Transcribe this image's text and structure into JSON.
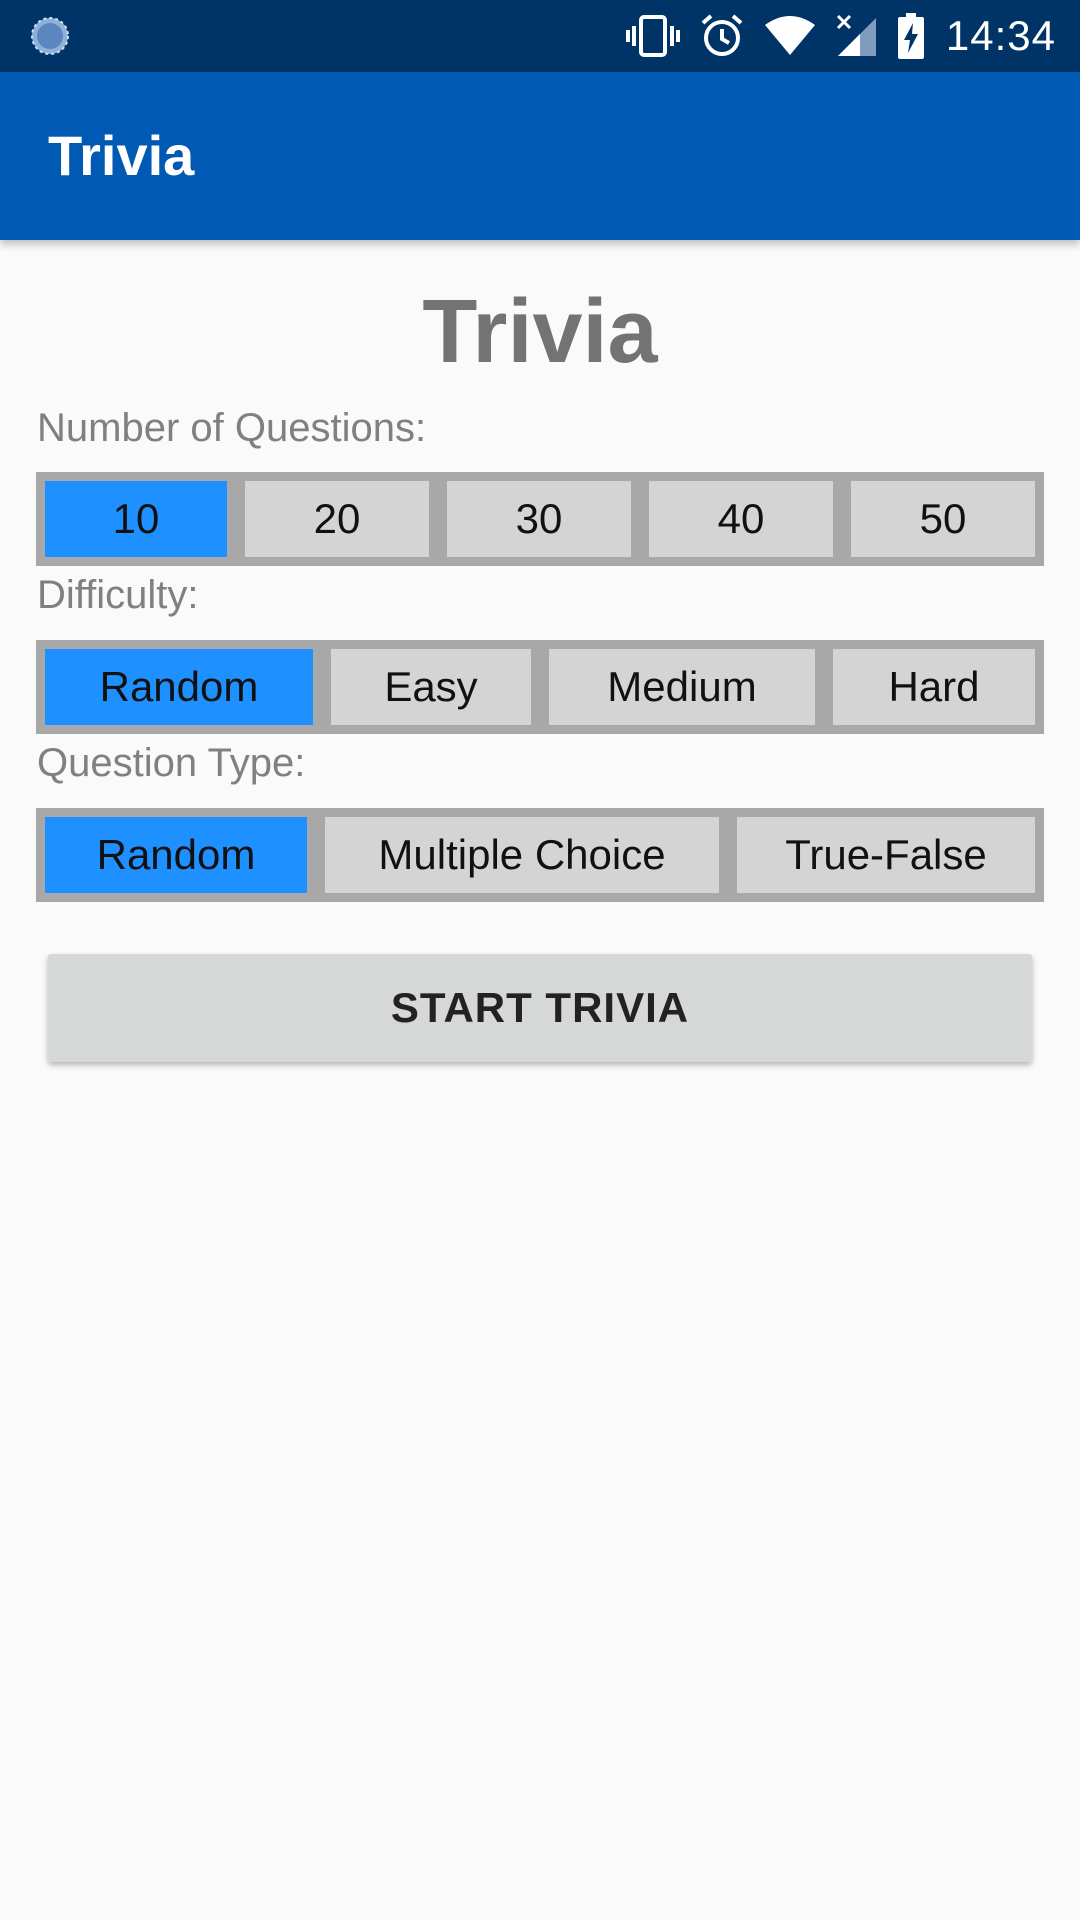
{
  "status_bar": {
    "time": "14:34",
    "icons": [
      "loading-spinner-icon",
      "vibrate-icon",
      "alarm-icon",
      "wifi-icon",
      "cell-signal-icon",
      "battery-charging-icon"
    ]
  },
  "app_bar": {
    "title": "Trivia"
  },
  "main": {
    "title": "Trivia",
    "number_of_questions": {
      "label": "Number of Questions:",
      "options": [
        "10",
        "20",
        "30",
        "40",
        "50"
      ],
      "selected": "10"
    },
    "difficulty": {
      "label": "Difficulty:",
      "options": [
        "Random",
        "Easy",
        "Medium",
        "Hard"
      ],
      "selected": "Random"
    },
    "question_type": {
      "label": "Question Type:",
      "options": [
        "Random",
        "Multiple Choice",
        "True-False"
      ],
      "selected": "Random"
    },
    "start_button_label": "START TRIVIA"
  },
  "colors": {
    "status_bar": "#003366",
    "app_bar": "#0059b3",
    "selected_option": "#1e90ff",
    "unselected_option": "#d4d4d4",
    "group_border": "#a8a8a8"
  }
}
